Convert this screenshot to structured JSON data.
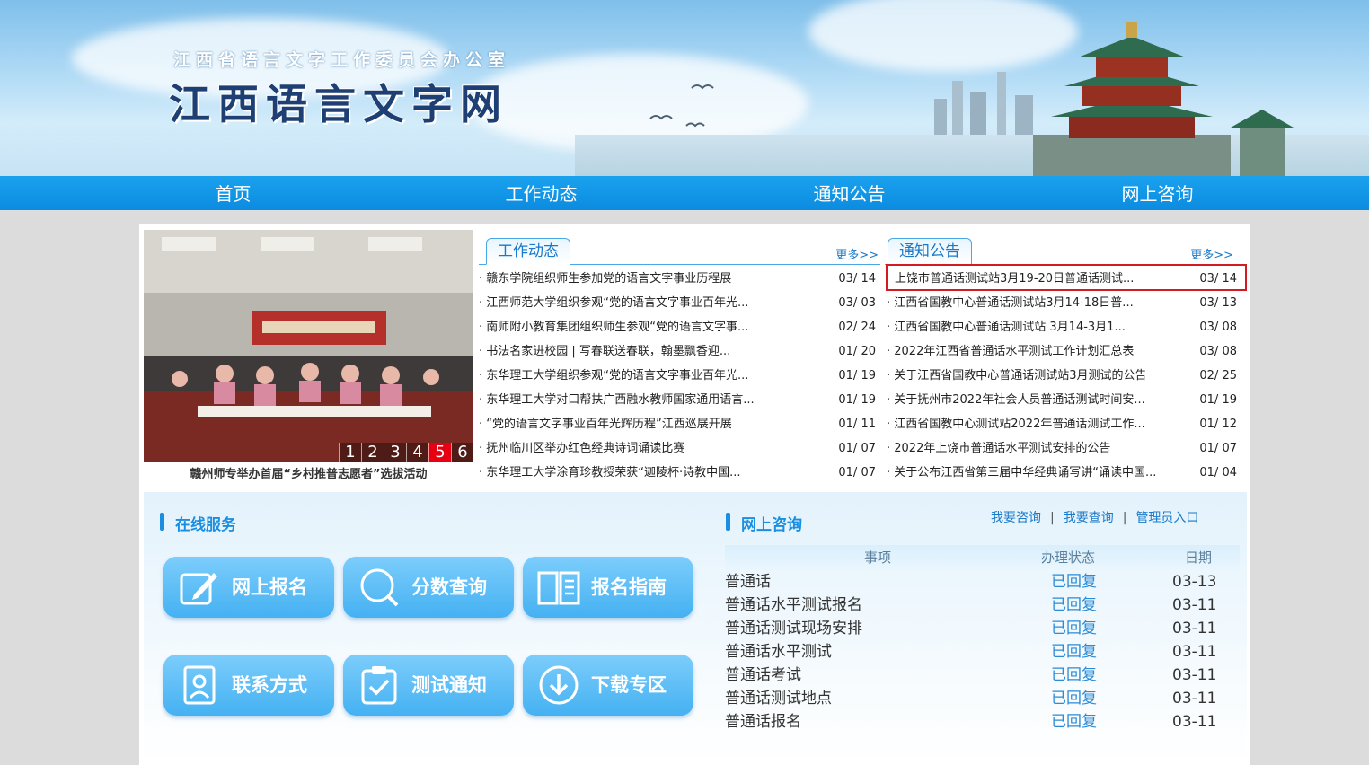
{
  "banner": {
    "subtitle": "江西省语言文字工作委员会办公室",
    "title": "江西语言文字网"
  },
  "nav": [
    "首页",
    "工作动态",
    "通知公告",
    "网上咨询"
  ],
  "slideshow": {
    "caption": "赣州师专举办首届“乡村推普志愿者”选拔活动",
    "pages": [
      "1",
      "2",
      "3",
      "4",
      "5",
      "6"
    ],
    "active_page": 5
  },
  "work_news": {
    "tab": "工作动态",
    "more": "更多>>",
    "items": [
      {
        "title": "· 赣东学院组织师生参加党的语言文字事业历程展",
        "date": "03/ 14"
      },
      {
        "title": "· 江西师范大学组织参观“党的语言文字事业百年光...",
        "date": "03/ 03"
      },
      {
        "title": "· 南师附小教育集团组织师生参观“党的语言文字事...",
        "date": "02/ 24"
      },
      {
        "title": "· 书法名家进校园 | 写春联送春联，翰墨飘香迎...",
        "date": "01/ 20"
      },
      {
        "title": "· 东华理工大学组织参观“党的语言文字事业百年光...",
        "date": "01/ 19"
      },
      {
        "title": "· 东华理工大学对口帮扶广西融水教师国家通用语言...",
        "date": "01/ 19"
      },
      {
        "title": "· “党的语言文字事业百年光辉历程”江西巡展开展",
        "date": "01/ 11"
      },
      {
        "title": "· 抚州临川区举办红色经典诗词诵读比赛",
        "date": "01/ 07"
      },
      {
        "title": "· 东华理工大学涂育珍教授荣获“迦陵杯·诗教中国...",
        "date": "01/ 07"
      }
    ]
  },
  "notices": {
    "tab": "通知公告",
    "more": "更多>>",
    "items": [
      {
        "title": "上饶市普通话测试站3月19-20日普通话测试...",
        "date": "03/ 14"
      },
      {
        "title": "· 江西省国教中心普通话测试站3月14-18日普...",
        "date": "03/ 13"
      },
      {
        "title": "· 江西省国教中心普通话测试站 3月14-3月1...",
        "date": "03/ 08"
      },
      {
        "title": "· 2022年江西省普通话水平测试工作计划汇总表",
        "date": "03/ 08"
      },
      {
        "title": "· 关于江西省国教中心普通话测试站3月测试的公告",
        "date": "02/ 25"
      },
      {
        "title": "· 关于抚州市2022年社会人员普通话测试时间安...",
        "date": "01/ 19"
      },
      {
        "title": "· 江西省国教中心测试站2022年普通话测试工作...",
        "date": "01/ 12"
      },
      {
        "title": "· 2022年上饶市普通话水平测试安排的公告",
        "date": "01/ 07"
      },
      {
        "title": "· 关于公布江西省第三届中华经典诵写讲“诵读中国...",
        "date": "01/ 04"
      }
    ]
  },
  "online_service": {
    "title": "在线服务",
    "buttons": [
      "网上报名",
      "分数查询",
      "报名指南",
      "联系方式",
      "测试通知",
      "下载专区"
    ]
  },
  "consult": {
    "title": "网上咨询",
    "links": [
      "我要咨询",
      "我要查询",
      "管理员入口"
    ],
    "separator": "|",
    "columns": [
      "事项",
      "办理状态",
      "日期"
    ],
    "rows": [
      {
        "item": "普通话",
        "status": "已回复",
        "date": "03-13"
      },
      {
        "item": "普通话水平测试报名",
        "status": "已回复",
        "date": "03-11"
      },
      {
        "item": "普通话测试现场安排",
        "status": "已回复",
        "date": "03-11"
      },
      {
        "item": "普通话水平测试",
        "status": "已回复",
        "date": "03-11"
      },
      {
        "item": "普通话考试",
        "status": "已回复",
        "date": "03-11"
      },
      {
        "item": "普通话测试地点",
        "status": "已回复",
        "date": "03-11"
      },
      {
        "item": "普通话报名",
        "status": "已回复",
        "date": "03-11"
      }
    ]
  },
  "colors": {
    "nav": "#0c8be0",
    "accent": "#1a8ee0",
    "highlight_border": "#d51b22",
    "active_page": "#e60012"
  }
}
